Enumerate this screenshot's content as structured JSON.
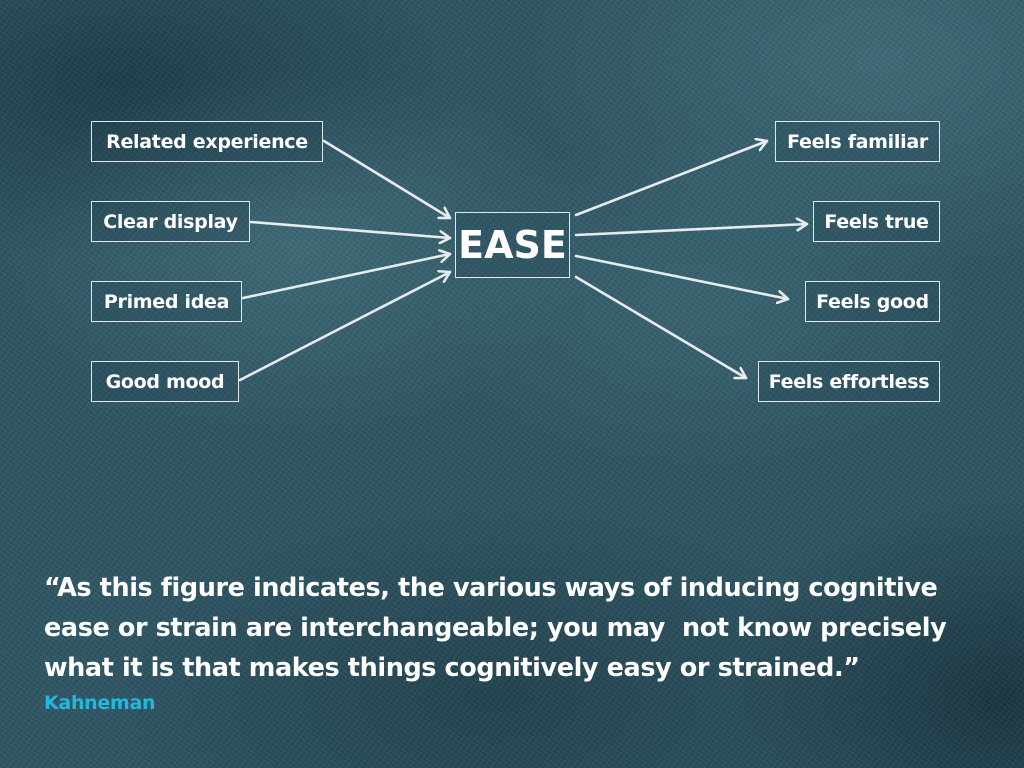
{
  "diagram": {
    "center": "EASE",
    "inputs": [
      "Related experience",
      "Clear display",
      "Primed idea",
      "Good mood"
    ],
    "outputs": [
      "Feels familiar",
      "Feels true",
      "Feels good",
      "Feels effortless"
    ],
    "edges": [
      {
        "from": "Related experience",
        "to": "EASE"
      },
      {
        "from": "Clear display",
        "to": "EASE"
      },
      {
        "from": "Primed idea",
        "to": "EASE"
      },
      {
        "from": "Good mood",
        "to": "EASE"
      },
      {
        "from": "EASE",
        "to": "Feels familiar"
      },
      {
        "from": "EASE",
        "to": "Feels true"
      },
      {
        "from": "EASE",
        "to": "Feels good"
      },
      {
        "from": "EASE",
        "to": "Feels effortless"
      }
    ]
  },
  "quote": {
    "lines": [
      "“As this figure indicates, the various ways of inducing cognitive",
      "ease or strain are interchangeable; you may  not know precisely",
      "what it is that makes things cognitively easy or strained.”"
    ],
    "author": "Kahneman"
  },
  "colors": {
    "background": "#2e5563",
    "box_border": "#dfe8ea",
    "text": "#ffffff",
    "author": "#1fb9dd"
  }
}
